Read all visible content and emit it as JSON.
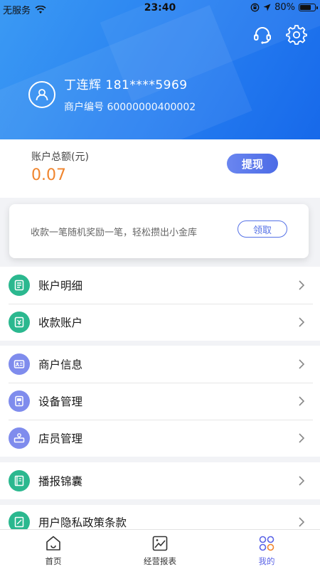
{
  "status_bar": {
    "carrier": "无服务",
    "time": "23:40",
    "battery": "80%",
    "battery_level": 0.8
  },
  "header": {
    "user_name": "丁连辉 181****5969",
    "merchant_no": "商户编号 60000000400002",
    "icons": [
      "headset-icon",
      "gear-icon"
    ]
  },
  "balance": {
    "label": "账户总额(元)",
    "amount": "0.07",
    "withdraw_label": "提现",
    "amount_color": "#f0852e"
  },
  "promo": {
    "text": "收款一笔随机奖励一笔，轻松攒出小金库",
    "button": "领取"
  },
  "menu_groups": [
    [
      {
        "label": "账户明细",
        "icon": "document-icon"
      },
      {
        "label": "收款账户",
        "icon": "receipt-icon"
      }
    ],
    [
      {
        "label": "商户信息",
        "icon": "id-card-icon"
      },
      {
        "label": "设备管理",
        "icon": "device-icon"
      },
      {
        "label": "店员管理",
        "icon": "clerk-icon"
      }
    ],
    [
      {
        "label": "播报锦囊",
        "icon": "book-icon"
      }
    ],
    [
      {
        "label": "用户隐私政策条款",
        "icon": "policy-icon"
      }
    ]
  ],
  "tabs": [
    {
      "label": "首页",
      "icon": "home-icon",
      "active": false
    },
    {
      "label": "经营报表",
      "icon": "report-icon",
      "active": false
    },
    {
      "label": "我的",
      "icon": "apps-icon",
      "active": true
    }
  ],
  "colors": {
    "brand_blue": "#2a83f2",
    "accent_purple": "#5a63e6",
    "green": "#2bb88f"
  }
}
